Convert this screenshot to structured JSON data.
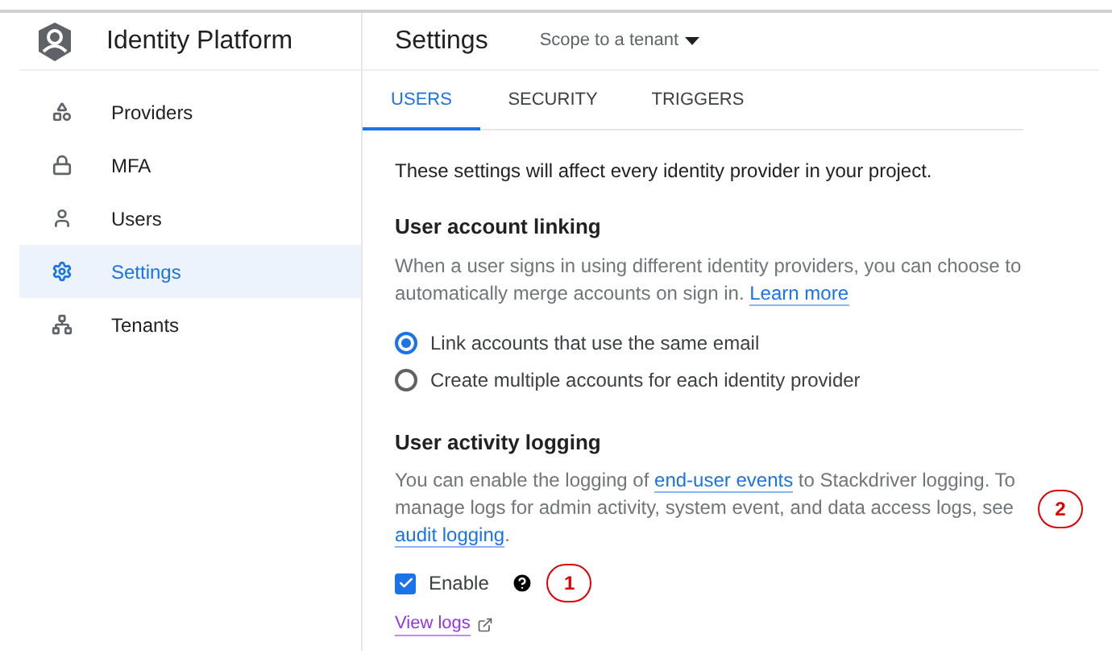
{
  "app": {
    "title": "Identity Platform"
  },
  "sidebar": {
    "items": [
      {
        "label": "Providers",
        "selected": false
      },
      {
        "label": "MFA",
        "selected": false
      },
      {
        "label": "Users",
        "selected": false
      },
      {
        "label": "Settings",
        "selected": true
      },
      {
        "label": "Tenants",
        "selected": false
      }
    ]
  },
  "header": {
    "title": "Settings",
    "scope_dropdown": "Scope to a tenant"
  },
  "tabs": [
    {
      "label": "USERS",
      "selected": true
    },
    {
      "label": "SECURITY",
      "selected": false
    },
    {
      "label": "TRIGGERS",
      "selected": false
    }
  ],
  "intro": "These settings will affect every identity provider in your project.",
  "account_linking": {
    "heading": "User account linking",
    "description": [
      {
        "kind": "text",
        "text": "When a user signs in using different identity providers, you can choose to automatically merge accounts on sign in. "
      },
      {
        "kind": "link",
        "text": "Learn more"
      }
    ],
    "options": [
      {
        "label": "Link accounts that use the same email",
        "selected": true
      },
      {
        "label": "Create multiple accounts for each identity provider",
        "selected": false
      }
    ]
  },
  "activity_logging": {
    "heading": "User activity logging",
    "description": [
      {
        "kind": "text",
        "text": "You can enable the logging of "
      },
      {
        "kind": "link",
        "text": "end-user events"
      },
      {
        "kind": "text",
        "text": " to Stackdriver logging. To manage logs for admin activity, system event, and data access logs, see "
      },
      {
        "kind": "link",
        "text": "audit logging"
      },
      {
        "kind": "text",
        "text": "."
      }
    ],
    "enable": {
      "label": "Enable",
      "checked": true
    },
    "view_logs": "View logs"
  },
  "annotations": [
    "1",
    "2"
  ]
}
